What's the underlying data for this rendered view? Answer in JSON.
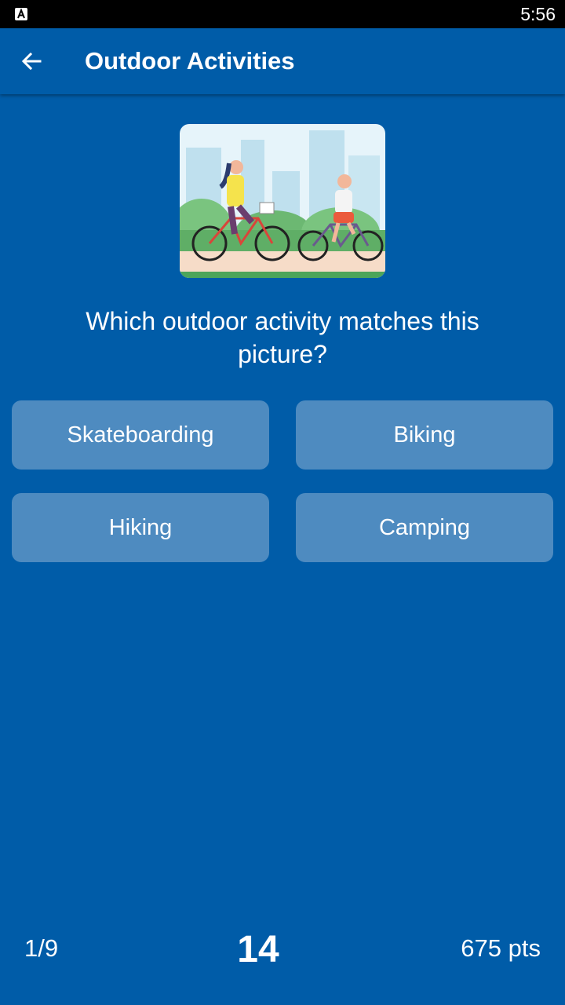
{
  "status_bar": {
    "time": "5:56",
    "app_icon": "a-badge-icon"
  },
  "app_bar": {
    "back_icon": "arrow-left-icon",
    "title": "Outdoor Activities"
  },
  "question": {
    "image_icon": "cyclists-illustration",
    "text": "Which outdoor activity matches this picture?"
  },
  "answers": [
    {
      "label": "Skateboarding"
    },
    {
      "label": "Biking"
    },
    {
      "label": "Hiking"
    },
    {
      "label": "Camping"
    }
  ],
  "footer": {
    "progress": "1/9",
    "timer": "14",
    "score": "675 pts"
  },
  "colors": {
    "background": "#005CA8",
    "answer_button": "#4E8BC0",
    "status_bar": "#000000"
  }
}
